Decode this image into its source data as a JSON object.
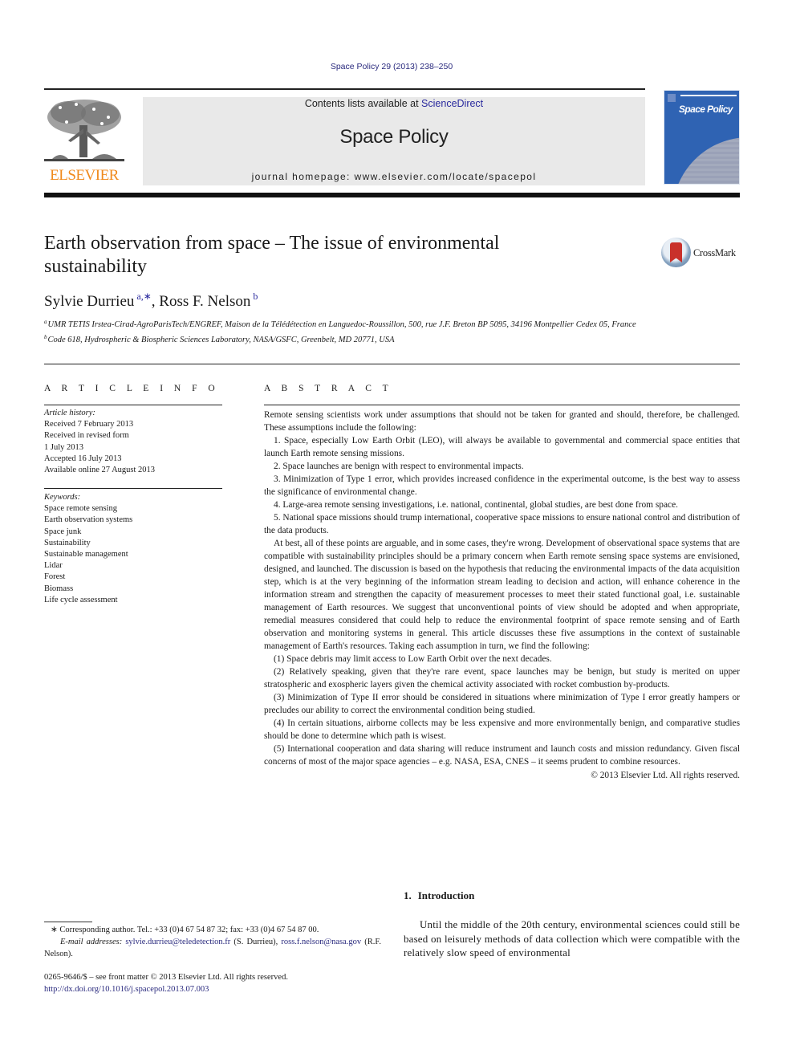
{
  "citation": "Space Policy 29 (2013) 238–250",
  "header": {
    "publisher_logo_text": "ELSEVIER",
    "contents_prefix": "Contents lists available at ",
    "contents_link": "ScienceDirect",
    "journal_name": "Space Policy",
    "homepage": "journal homepage: www.elsevier.com/locate/spacepol",
    "cover_title": "Space Policy"
  },
  "article": {
    "title": "Earth observation from space – The issue of environmental sustainability",
    "crossmark_label": "CrossMark",
    "authors": [
      {
        "name": "Sylvie Durrieu",
        "marks": "a,∗"
      },
      {
        "name": "Ross F. Nelson",
        "marks": "b"
      }
    ],
    "author_separator": ", ",
    "affiliations": [
      {
        "mark": "a",
        "text": "UMR TETIS Irstea-Cirad-AgroParisTech/ENGREF, Maison de la Télédétection en Languedoc-Roussillon, 500, rue J.F. Breton BP 5095, 34196 Montpellier Cedex 05, France"
      },
      {
        "mark": "b",
        "text": "Code 618, Hydrospheric & Biospheric Sciences Laboratory, NASA/GSFC, Greenbelt, MD 20771, USA"
      }
    ]
  },
  "article_info": {
    "label": "A R T I C L E   I N F O",
    "history_heading": "Article history:",
    "history": [
      "Received 7 February 2013",
      "Received in revised form",
      "1 July 2013",
      "Accepted 16 July 2013",
      "Available online 27 August 2013"
    ],
    "keywords_heading": "Keywords:",
    "keywords": [
      "Space remote sensing",
      "Earth observation systems",
      "Space junk",
      "Sustainability",
      "Sustainable management",
      "Lidar",
      "Forest",
      "Biomass",
      "Life cycle assessment"
    ]
  },
  "abstract": {
    "label": "A B S T R A C T",
    "paragraphs": [
      "Remote sensing scientists work under assumptions that should not be taken for granted and should, therefore, be challenged. These assumptions include the following:",
      "1. Space, especially Low Earth Orbit (LEO), will always be available to governmental and commercial space entities that launch Earth remote sensing missions.",
      "2. Space launches are benign with respect to environmental impacts.",
      "3. Minimization of Type 1 error, which provides increased confidence in the experimental outcome, is the best way to assess the significance of environmental change.",
      "4. Large-area remote sensing investigations, i.e. national, continental, global studies, are best done from space.",
      "5. National space missions should trump international, cooperative space missions to ensure national control and distribution of the data products.",
      "At best, all of these points are arguable, and in some cases, they're wrong. Development of observational space systems that are compatible with sustainability principles should be a primary concern when Earth remote sensing space systems are envisioned, designed, and launched. The discussion is based on the hypothesis that reducing the environmental impacts of the data acquisition step, which is at the very beginning of the information stream leading to decision and action, will enhance coherence in the information stream and strengthen the capacity of measurement processes to meet their stated functional goal, i.e. sustainable management of Earth resources. We suggest that unconventional points of view should be adopted and when appropriate, remedial measures considered that could help to reduce the environmental footprint of space remote sensing and of Earth observation and monitoring systems in general. This article discusses these five assumptions in the context of sustainable management of Earth's resources. Taking each assumption in turn, we find the following:",
      "(1) Space debris may limit access to Low Earth Orbit over the next decades.",
      "(2) Relatively speaking, given that they're rare event, space launches may be benign, but study is merited on upper stratospheric and exospheric layers given the chemical activity associated with rocket combustion by-products.",
      "(3) Minimization of Type II error should be considered in situations where minimization of Type I error greatly hampers or precludes our ability to correct the environmental condition being studied.",
      "(4) In certain situations, airborne collects may be less expensive and more environmentally benign, and comparative studies should be done to determine which path is wisest.",
      "(5) International cooperation and data sharing will reduce instrument and launch costs and mission redundancy. Given fiscal concerns of most of the major space agencies – e.g. NASA, ESA, CNES – it seems prudent to combine resources."
    ],
    "copyright": "© 2013 Elsevier Ltd. All rights reserved."
  },
  "footnotes": {
    "corresponding": "∗  Corresponding author. Tel.: +33 (0)4 67 54 87 32; fax: +33 (0)4 67 54 87 00.",
    "email_label": "E-mail addresses:",
    "email1": "sylvie.durrieu@teledetection.fr",
    "email1_owner": " (S. Durrieu), ",
    "email2": "ross.f.nelson@nasa.gov",
    "email2_owner": " (R.F. Nelson).",
    "issn": "0265-9646/$ – see front matter © 2013 Elsevier Ltd. All rights reserved.",
    "doi": "http://dx.doi.org/10.1016/j.spacepol.2013.07.003"
  },
  "introduction": {
    "number": "1.",
    "heading": "Introduction",
    "text": "Until the middle of the 20th century, environmental sciences could still be based on leisurely methods of data collection which were compatible with the relatively slow speed of environmental"
  }
}
